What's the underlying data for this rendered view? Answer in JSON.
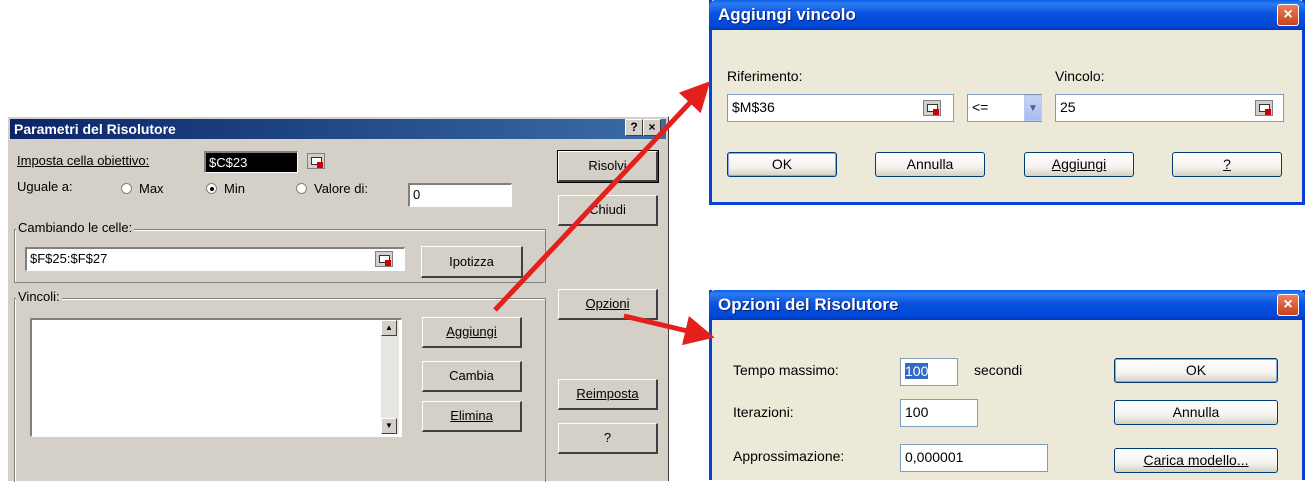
{
  "solver": {
    "title": "Parametri del Risolutore",
    "help_btn": "?",
    "close_btn": "×",
    "target_label": "Imposta cella obiettivo:",
    "target_value": "$C$23",
    "equal_label": "Uguale a:",
    "opt_max": "Max",
    "opt_min": "Min",
    "opt_value": "Valore di:",
    "value_field": "0",
    "changing_label": "Cambiando le celle:",
    "changing_value": "$F$25:$F$27",
    "guess_btn": "Ipotizza",
    "constraints_label": "Vincoli:",
    "add_btn": "Aggiungi",
    "change_btn": "Cambia",
    "delete_btn": "Elimina",
    "solve_btn": "Risolvi",
    "close_label": "Chiudi",
    "options_btn": "Opzioni",
    "reset_btn": "Reimposta",
    "help_label": "?"
  },
  "add_constraint": {
    "title": "Aggiungi vincolo",
    "ref_label": "Riferimento:",
    "ref_value": "$M$36",
    "operator": "<=",
    "constraint_label": "Vincolo:",
    "constraint_value": "25",
    "ok": "OK",
    "cancel": "Annulla",
    "add": "Aggiungi",
    "help": "?",
    "close": "×"
  },
  "options": {
    "title": "Opzioni del Risolutore",
    "time_label": "Tempo massimo:",
    "time_value": "100",
    "time_unit": "secondi",
    "iter_label": "Iterazioni:",
    "iter_value": "100",
    "precision_label": "Approssimazione:",
    "precision_value": "0,000001",
    "ok": "OK",
    "cancel": "Annulla",
    "load_model": "Carica modello...",
    "close": "×"
  },
  "colors": {
    "arrow": "#e3201b",
    "xp_title": "#0a53df",
    "classic_title": "#0a246a"
  }
}
